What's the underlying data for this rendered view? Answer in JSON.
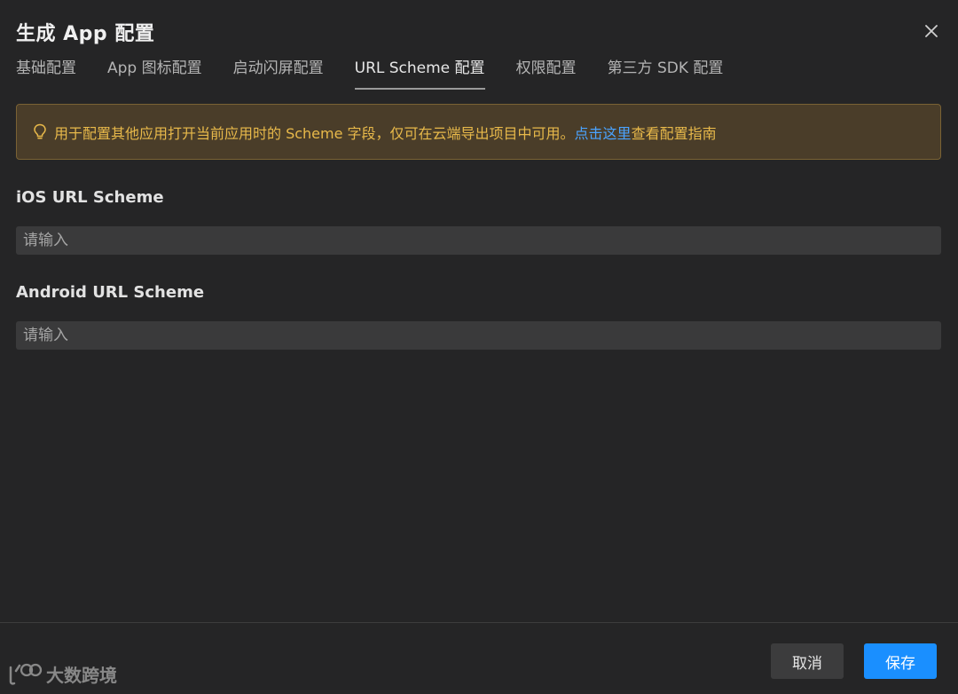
{
  "dialog": {
    "title": "生成 App 配置"
  },
  "tabs": [
    {
      "label": "基础配置",
      "active": false
    },
    {
      "label": "App 图标配置",
      "active": false
    },
    {
      "label": "启动闪屏配置",
      "active": false
    },
    {
      "label": "URL Scheme 配置",
      "active": true
    },
    {
      "label": "权限配置",
      "active": false
    },
    {
      "label": "第三方 SDK 配置",
      "active": false
    }
  ],
  "alert": {
    "icon": "lightbulb-icon",
    "text_before": "用于配置其他应用打开当前应用时的 Scheme 字段，仅可在云端导出项目中可用。",
    "link_text": "点击这里",
    "text_after": "查看配置指南",
    "text_color": "#e8b94a",
    "link_color": "#4aa3ff"
  },
  "fields": {
    "ios": {
      "label": "iOS URL Scheme",
      "value": "",
      "placeholder": "请输入"
    },
    "android": {
      "label": "Android URL Scheme",
      "value": "",
      "placeholder": "请输入"
    }
  },
  "footer": {
    "cancel_label": "取消",
    "save_label": "保存",
    "primary_color": "#1a8fff"
  },
  "watermark": {
    "text": "大数跨境"
  }
}
